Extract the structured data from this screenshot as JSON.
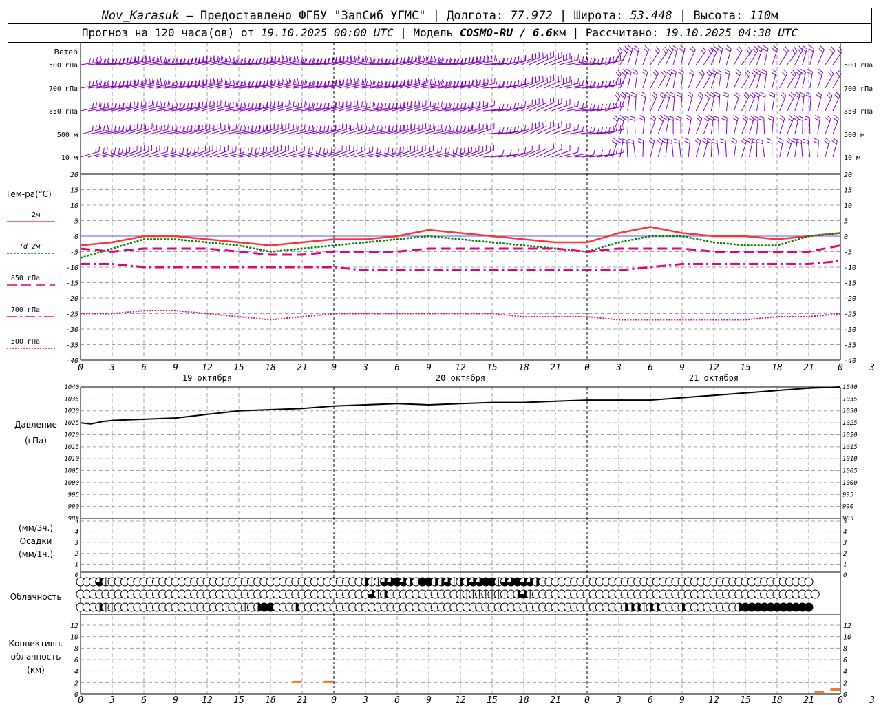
{
  "header": {
    "station": "Nov_Karasuk",
    "provider": " – Предоставлено ФГБУ \"ЗапСиб УГМС\" | Долгота: ",
    "lon": "77.972",
    "lat_label": " | Широта: ",
    "lat": "53.448",
    "alt_label": " | Высота: ",
    "alt": "110",
    "alt_unit": "м",
    "forecast_prefix": "Прогноз на 120 часа(ов) от ",
    "forecast_time": "19.10.2025 00:00 UTC",
    "model_label": "  | Модель ",
    "model": "COSMO-RU / 6.6",
    "model_unit": "км",
    "calc_label": " | Рассчитано: ",
    "calc_time": "19.10.2025 04:38 UTC"
  },
  "wind_panel": {
    "title": "Ветер",
    "levels": [
      "500 гПа",
      "700 гПа",
      "850 гПа",
      "500 м",
      "10 м"
    ],
    "color": "#7f00bf"
  },
  "temp_panel": {
    "title": "Тем-ра(°C)",
    "legend": [
      {
        "label": "2м",
        "color": "#ff3333",
        "style": "solid"
      },
      {
        "label": "Td 2м",
        "color": "#008000",
        "style": "dotted"
      },
      {
        "label": "850 гПа",
        "color": "#e6007e",
        "style": "dashed"
      },
      {
        "label": "700 гПа",
        "color": "#e6007e",
        "style": "dashdot"
      },
      {
        "label": "500 гПа",
        "color": "#e6007e",
        "style": "fine-dotted"
      }
    ]
  },
  "pressure_panel": {
    "title": "Давление",
    "unit": "(гПа)"
  },
  "precip_panel": {
    "unit1": "(мм/3ч.)",
    "title": "Осадки",
    "unit2": "(мм/1ч.)"
  },
  "cloud_panel": {
    "title": "Облачность"
  },
  "conv_panel": {
    "title1": "Конвективн.",
    "title2": "облачность",
    "unit": "(км)"
  },
  "time_axis": {
    "hour_labels": [
      "0",
      "3",
      "6",
      "9",
      "12",
      "15",
      "18",
      "21",
      "0",
      "3",
      "6",
      "9",
      "12",
      "15",
      "18",
      "21",
      "0",
      "3",
      "6",
      "9",
      "12",
      "15",
      "18",
      "21",
      "0",
      "3",
      "6"
    ],
    "day_labels": [
      "19 октября",
      "20 октября",
      "21 октября"
    ]
  },
  "chart_data": [
    {
      "type": "line",
      "title": "Тем-ра(°C)",
      "xlabel": "",
      "ylabel": "",
      "x_hours": [
        0,
        3,
        6,
        9,
        12,
        15,
        18,
        21,
        24,
        27,
        30,
        33,
        36,
        39,
        42,
        45,
        48,
        51,
        54,
        57,
        60,
        63,
        66,
        69,
        72
      ],
      "ylim": [
        -40,
        20
      ],
      "yticks": [
        -40,
        -35,
        -30,
        -25,
        -20,
        -15,
        -10,
        -5,
        0,
        5,
        10,
        15,
        20
      ],
      "series": [
        {
          "name": "2м",
          "color": "#ff3333",
          "values": [
            -3,
            -2,
            0,
            0,
            -1,
            -2,
            -3,
            -2,
            -1,
            -1,
            0,
            2,
            1,
            0,
            -1,
            -2,
            -2,
            1,
            3,
            1,
            0,
            0,
            -1,
            0,
            1
          ]
        },
        {
          "name": "Td 2м",
          "color": "#008000",
          "values": [
            -7,
            -4,
            -1,
            -1,
            -2,
            -3,
            -5,
            -4,
            -3,
            -2,
            -1,
            0,
            -1,
            -2,
            -3,
            -4,
            -5,
            -2,
            0,
            0,
            -2,
            -3,
            -3,
            0,
            1
          ]
        },
        {
          "name": "850 гПа",
          "color": "#e6007e",
          "values": [
            -4,
            -5,
            -4,
            -4,
            -4,
            -5,
            -6,
            -6,
            -5,
            -5,
            -5,
            -4,
            -4,
            -4,
            -4,
            -4,
            -5,
            -4,
            -4,
            -4,
            -5,
            -5,
            -5,
            -5,
            -3
          ]
        },
        {
          "name": "700 гПа",
          "color": "#e6007e",
          "values": [
            -9,
            -9,
            -10,
            -10,
            -10,
            -10,
            -10,
            -10,
            -10,
            -11,
            -11,
            -11,
            -11,
            -11,
            -11,
            -11,
            -11,
            -11,
            -10,
            -9,
            -9,
            -9,
            -9,
            -9,
            -8
          ]
        },
        {
          "name": "500 гПа",
          "color": "#e6007e",
          "values": [
            -25,
            -25,
            -24,
            -24,
            -25,
            -26,
            -27,
            -26,
            -25,
            -25,
            -25,
            -25,
            -25,
            -25,
            -26,
            -26,
            -26,
            -27,
            -27,
            -27,
            -27,
            -27,
            -26,
            -26,
            -25
          ]
        }
      ]
    },
    {
      "type": "line",
      "title": "Давление",
      "xlabel": "",
      "ylabel": "(гПа)",
      "x_hours": [
        0,
        1,
        2,
        3,
        6,
        9,
        12,
        15,
        18,
        21,
        24,
        27,
        30,
        33,
        36,
        39,
        42,
        45,
        48,
        51,
        54,
        57,
        60,
        63,
        66,
        69,
        72
      ],
      "ylim": [
        985,
        1040
      ],
      "yticks": [
        985,
        990,
        995,
        1000,
        1005,
        1010,
        1015,
        1020,
        1025,
        1030,
        1035,
        1040
      ],
      "series": [
        {
          "name": "",
          "color": "#000000",
          "values": [
            1025,
            1024.5,
            1025.5,
            1026,
            1026.5,
            1027,
            1028.5,
            1030,
            1030.5,
            1031,
            1032,
            1032.5,
            1033,
            1032.5,
            1033,
            1033.5,
            1033.5,
            1034,
            1034.5,
            1034.5,
            1034.5,
            1035.5,
            1036.5,
            1037.5,
            1038.5,
            1039.5,
            1040
          ]
        }
      ]
    },
    {
      "type": "bar",
      "title": "Осадки",
      "ylim": [
        0,
        5
      ],
      "yticks": [
        0,
        1,
        2,
        3,
        4,
        5
      ],
      "values": []
    },
    {
      "type": "bar",
      "title": "Конвективн. облачность (км)",
      "ylim": [
        0,
        13
      ],
      "yticks": [
        0,
        2,
        4,
        6,
        8,
        10,
        12
      ],
      "bars": [
        {
          "x_hour": 20.5,
          "base": 2,
          "top": 2.3,
          "color": "#ee7d2b"
        },
        {
          "x_hour": 23.5,
          "base": 2,
          "top": 2.3,
          "color": "#ee7d2b"
        },
        {
          "x_hour": 70,
          "base": 0.4,
          "top": 0.5,
          "color": "#ee7d2b"
        },
        {
          "x_hour": 71.5,
          "base": 0.6,
          "top": 1,
          "color": "#ee7d2b"
        }
      ]
    }
  ],
  "cloud_rows": {
    "legend": "row1 = upper, row2 = middle, row3 = lower; 0 = clear, 1 = quarter, 2 = half, 3 = three-quarter, 4 = overcast",
    "upper": [
      0,
      0,
      0,
      3,
      1,
      0,
      0,
      0,
      0,
      0,
      0,
      0,
      0,
      0,
      0,
      0,
      0,
      0,
      0,
      0,
      0,
      0,
      0,
      0,
      0,
      0,
      0,
      0,
      0,
      0,
      0,
      0,
      0,
      0,
      0,
      0,
      0,
      0,
      0,
      0,
      0,
      0,
      0,
      0,
      0,
      2,
      1,
      1,
      3,
      3,
      4,
      3,
      2,
      1,
      4,
      4,
      2,
      2,
      3,
      1,
      2,
      2,
      3,
      3,
      4,
      4,
      1,
      3,
      3,
      4,
      3,
      3,
      2,
      0,
      0,
      0,
      0,
      0,
      0,
      0,
      0,
      0,
      0,
      0,
      0,
      0,
      0,
      0,
      0,
      0,
      0,
      0,
      0,
      0,
      0,
      0,
      0,
      0,
      0,
      0,
      0,
      0,
      0,
      0,
      0,
      0,
      0,
      0,
      0,
      0,
      0,
      0,
      0,
      0,
      0,
      0
    ],
    "middle": [
      0,
      0,
      0,
      0,
      0,
      0,
      0,
      0,
      0,
      0,
      0,
      0,
      0,
      0,
      0,
      0,
      0,
      0,
      0,
      0,
      0,
      0,
      0,
      0,
      0,
      0,
      0,
      0,
      0,
      0,
      0,
      0,
      0,
      0,
      0,
      0,
      0,
      0,
      0,
      0,
      0,
      0,
      0,
      0,
      0,
      0,
      3,
      1,
      2,
      0,
      0,
      0,
      0,
      0,
      0,
      0,
      0,
      0,
      0,
      0,
      1,
      1,
      1,
      1,
      1,
      1,
      1,
      1,
      1,
      2,
      3,
      1,
      0,
      0,
      0,
      0,
      0,
      0,
      0,
      0,
      0,
      0,
      0,
      0,
      0,
      0,
      0,
      0,
      0,
      0,
      0,
      0,
      0,
      0,
      0,
      0,
      0,
      0,
      0,
      0,
      0,
      0,
      0,
      0,
      0,
      0,
      0,
      0,
      0,
      0,
      0,
      0,
      0,
      0,
      0,
      0,
      0
    ],
    "lower": [
      0,
      0,
      0,
      2,
      1,
      1,
      0,
      0,
      0,
      0,
      0,
      0,
      0,
      0,
      0,
      0,
      0,
      0,
      0,
      0,
      0,
      0,
      0,
      0,
      0,
      0,
      1,
      0,
      2,
      4,
      4,
      0,
      0,
      0,
      2,
      0,
      0,
      0,
      0,
      0,
      0,
      0,
      0,
      0,
      0,
      0,
      0,
      0,
      0,
      0,
      0,
      0,
      0,
      0,
      0,
      0,
      0,
      0,
      0,
      0,
      0,
      0,
      0,
      0,
      0,
      0,
      0,
      0,
      0,
      0,
      0,
      0,
      0,
      0,
      0,
      0,
      0,
      0,
      0,
      0,
      0,
      0,
      0,
      0,
      0,
      0,
      2,
      2,
      2,
      1,
      2,
      2,
      0,
      0,
      0,
      2,
      0,
      0,
      0,
      0,
      0,
      0,
      0,
      0,
      2,
      4,
      4,
      4,
      4,
      4,
      4,
      4,
      4,
      4,
      4,
      4
    ]
  }
}
